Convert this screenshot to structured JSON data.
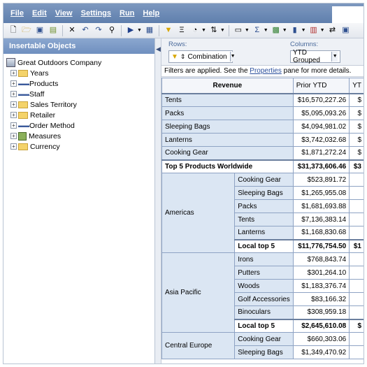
{
  "menu": [
    "File",
    "Edit",
    "View",
    "Settings",
    "Run",
    "Help"
  ],
  "toolbar": {
    "icons": [
      "new-icon",
      "open-icon",
      "save-icon",
      "save-as-icon",
      "cut-icon",
      "undo-icon",
      "redo-icon",
      "find-icon",
      "run-icon",
      "run-menu-icon",
      "filter-icon",
      "suppress-icon",
      "calculation-icon",
      "sort-icon",
      "chart-type-icon",
      "summary-icon",
      "explain-icon",
      "bar-chart-icon",
      "chart-icon",
      "swap-icon",
      "nest-icon"
    ]
  },
  "left_panel": {
    "title": "Insertable Objects",
    "tree": {
      "root": "Great Outdoors Company",
      "items": [
        "Years",
        "Products",
        "Staff",
        "Sales Territory",
        "Retailer",
        "Order Method",
        "Measures",
        "Currency"
      ]
    }
  },
  "dropzones": {
    "rows_label": "Rows:",
    "rows_value": "Combination",
    "columns_label": "Columns:",
    "columns_value": "YTD Grouped"
  },
  "filter_message": {
    "prefix": "Filters are applied. See the ",
    "link": "Properties",
    "suffix": " pane for more details."
  },
  "crosstab": {
    "corner": "Revenue",
    "columns": [
      "Prior YTD",
      "YT"
    ],
    "top_rows": [
      {
        "label": "Tents",
        "value": "$16,570,227.26",
        "next": "$"
      },
      {
        "label": "Packs",
        "value": "$5,095,093.26",
        "next": "$"
      },
      {
        "label": "Sleeping Bags",
        "value": "$4,094,981.02",
        "next": "$"
      },
      {
        "label": "Lanterns",
        "value": "$3,742,032.68",
        "next": "$"
      },
      {
        "label": "Cooking Gear",
        "value": "$1,871,272.24",
        "next": "$"
      }
    ],
    "top_total": {
      "label": "Top 5 Products Worldwide",
      "value": "$31,373,606.46",
      "next": "$3"
    },
    "groups": [
      {
        "region": "Americas",
        "rows": [
          {
            "label": "Cooking Gear",
            "value": "$523,891.72"
          },
          {
            "label": "Sleeping Bags",
            "value": "$1,265,955.08"
          },
          {
            "label": "Packs",
            "value": "$1,681,693.88"
          },
          {
            "label": "Tents",
            "value": "$7,136,383.14"
          },
          {
            "label": "Lanterns",
            "value": "$1,168,830.68"
          }
        ],
        "total": {
          "label": "Local top 5",
          "value": "$11,776,754.50",
          "next": "$1"
        }
      },
      {
        "region": "Asia Pacific",
        "rows": [
          {
            "label": "Irons",
            "value": "$768,843.74"
          },
          {
            "label": "Putters",
            "value": "$301,264.10"
          },
          {
            "label": "Woods",
            "value": "$1,183,376.74"
          },
          {
            "label": "Golf Accessories",
            "value": "$83,166.32"
          },
          {
            "label": "Binoculars",
            "value": "$308,959.18"
          }
        ],
        "total": {
          "label": "Local top 5",
          "value": "$2,645,610.08",
          "next": "$"
        }
      },
      {
        "region": "Central Europe",
        "rows": [
          {
            "label": "Cooking Gear",
            "value": "$660,303.06"
          },
          {
            "label": "Sleeping Bags",
            "value": "$1,349,470.92"
          }
        ]
      }
    ]
  }
}
